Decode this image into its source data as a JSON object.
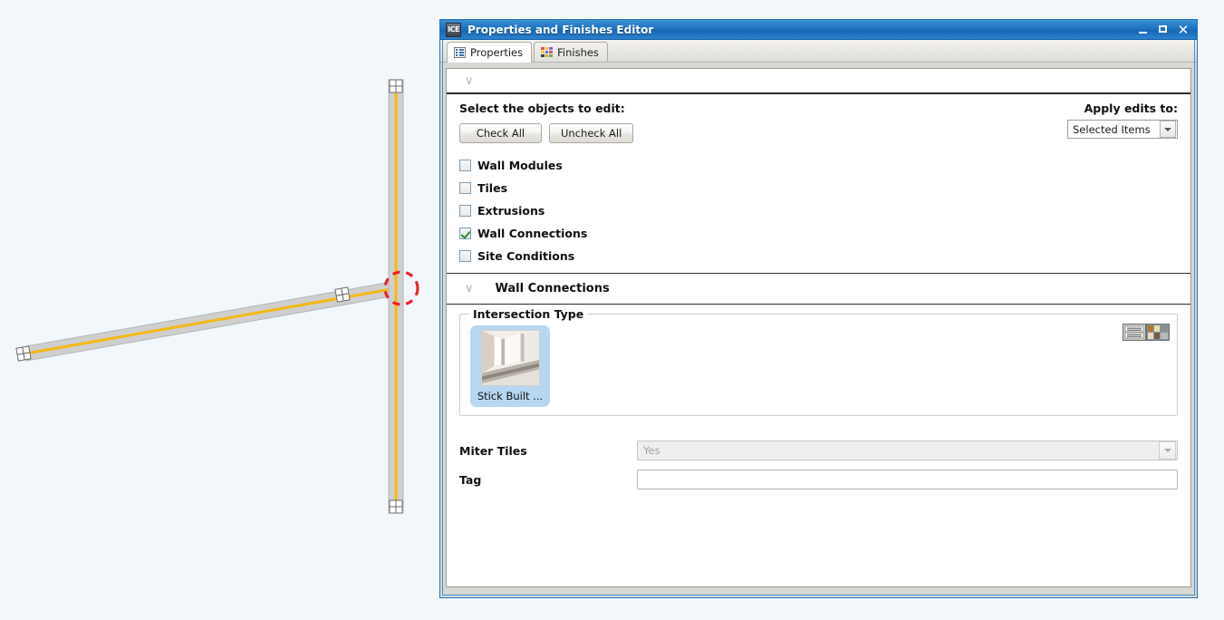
{
  "window": {
    "app_icon_text": "ICE",
    "title": "Properties and Finishes Editor",
    "minimize_label": "",
    "maximize_label": "",
    "close_label": "✕"
  },
  "tabs": [
    {
      "label": "Properties",
      "icon": "list-icon",
      "active": true
    },
    {
      "label": "Finishes",
      "icon": "color-grid-icon",
      "active": false
    }
  ],
  "collapse_bar": {
    "chevron": "∨"
  },
  "select_region": {
    "title": "Select the objects to edit:",
    "apply_edits_label": "Apply edits to:",
    "apply_edits_value": "Selected Items",
    "check_all_label": "Check All",
    "uncheck_all_label": "Uncheck All",
    "checkboxes": [
      {
        "label": "Wall Modules",
        "checked": false
      },
      {
        "label": "Tiles",
        "checked": false
      },
      {
        "label": "Extrusions",
        "checked": false
      },
      {
        "label": "Wall Connections",
        "checked": true
      },
      {
        "label": "Site Conditions",
        "checked": false
      }
    ]
  },
  "section": {
    "chevron": "∨",
    "title": "Wall Connections"
  },
  "intersection_type": {
    "legend": "Intersection Type",
    "selected_thumb_label": "Stick Built ...",
    "view_toggle_list": "list-view-icon",
    "view_toggle_thumb": "thumbnail-view-icon"
  },
  "fields": [
    {
      "label": "Miter Tiles",
      "type": "combo",
      "value": "Yes",
      "disabled": true
    },
    {
      "label": "Tag",
      "type": "text",
      "value": "",
      "placeholder": ""
    }
  ],
  "cad": {
    "canvas_background": "#f1f7fb",
    "wall_fill": "#c9c9c9",
    "centerline_color": "#f5b914",
    "highlight_circle_color": "#ee1c25"
  }
}
